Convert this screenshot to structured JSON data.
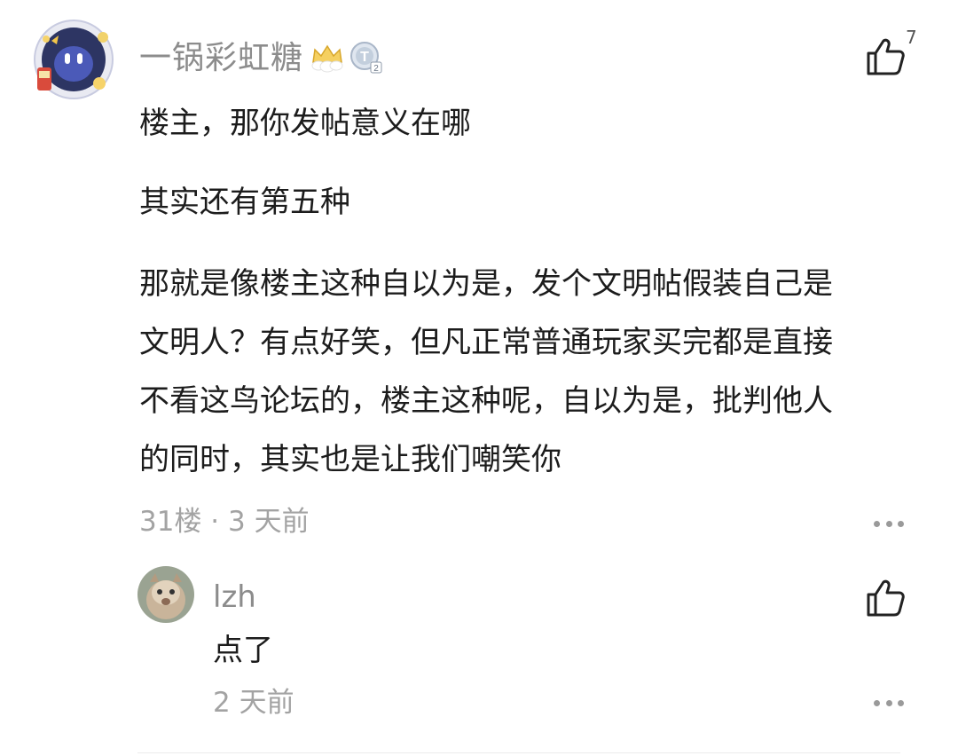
{
  "comment": {
    "username": "一锅彩虹糖",
    "like_count": "7",
    "paragraphs": [
      "楼主，那你发帖意义在哪",
      "其实还有第五种",
      "那就是像楼主这种自以为是，发个文明帖假装自己是\n文明人？有点好笑，但凡正常普通玩家买完都是直接\n不看这鸟论坛的，楼主这种呢，自以为是，批判他人\n的同时，其实也是让我们嘲笑你"
    ],
    "meta": "31楼 · 3 天前",
    "badge_level_text": "T2"
  },
  "reply": {
    "username": "lzh",
    "text": "点了",
    "meta": "2 天前"
  },
  "colors": {
    "username": "#8c8c8c",
    "meta": "#a3a3a3",
    "body_text": "#1c1c1c"
  }
}
